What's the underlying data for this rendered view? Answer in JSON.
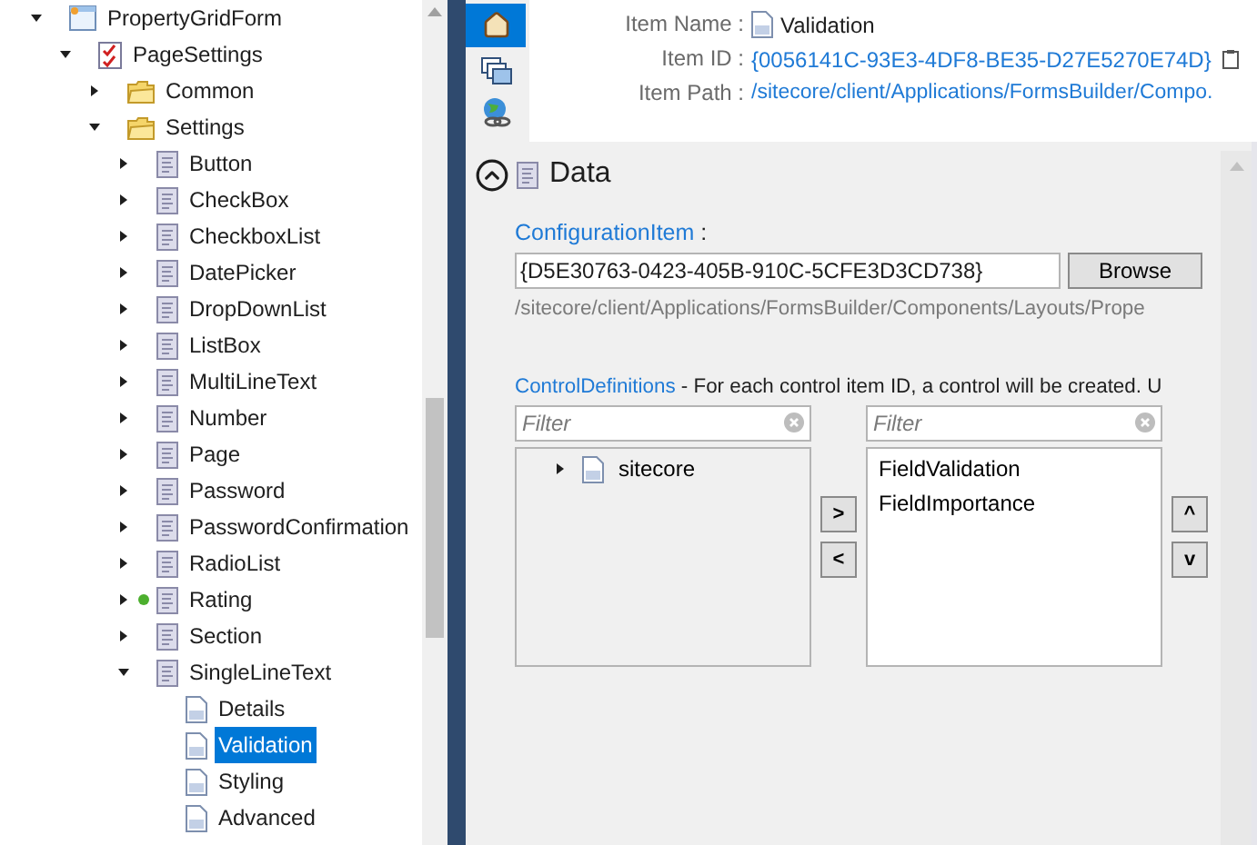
{
  "tree": [
    {
      "label": "PropertyGridForm",
      "kind": "form",
      "expanded": true,
      "selected": false,
      "marked": false,
      "children": [
        {
          "label": "PageSettings",
          "kind": "checklist",
          "expanded": true,
          "selected": false,
          "marked": false,
          "children": [
            {
              "label": "Common",
              "kind": "folder",
              "expanded": false,
              "selected": false,
              "marked": false
            },
            {
              "label": "Settings",
              "kind": "folder",
              "expanded": true,
              "selected": false,
              "marked": false,
              "children": [
                {
                  "label": "Button",
                  "kind": "template",
                  "expanded": false,
                  "selected": false,
                  "marked": false
                },
                {
                  "label": "CheckBox",
                  "kind": "template",
                  "expanded": false,
                  "selected": false,
                  "marked": false
                },
                {
                  "label": "CheckboxList",
                  "kind": "template",
                  "expanded": false,
                  "selected": false,
                  "marked": false
                },
                {
                  "label": "DatePicker",
                  "kind": "template",
                  "expanded": false,
                  "selected": false,
                  "marked": false
                },
                {
                  "label": "DropDownList",
                  "kind": "template",
                  "expanded": false,
                  "selected": false,
                  "marked": false
                },
                {
                  "label": "ListBox",
                  "kind": "template",
                  "expanded": false,
                  "selected": false,
                  "marked": false
                },
                {
                  "label": "MultiLineText",
                  "kind": "template",
                  "expanded": false,
                  "selected": false,
                  "marked": false
                },
                {
                  "label": "Number",
                  "kind": "template",
                  "expanded": false,
                  "selected": false,
                  "marked": false
                },
                {
                  "label": "Page",
                  "kind": "template",
                  "expanded": false,
                  "selected": false,
                  "marked": false
                },
                {
                  "label": "Password",
                  "kind": "template",
                  "expanded": false,
                  "selected": false,
                  "marked": false
                },
                {
                  "label": "PasswordConfirmation",
                  "kind": "template",
                  "expanded": false,
                  "selected": false,
                  "marked": false
                },
                {
                  "label": "RadioList",
                  "kind": "template",
                  "expanded": false,
                  "selected": false,
                  "marked": false
                },
                {
                  "label": "Rating",
                  "kind": "template",
                  "expanded": false,
                  "selected": false,
                  "marked": true
                },
                {
                  "label": "Section",
                  "kind": "template",
                  "expanded": false,
                  "selected": false,
                  "marked": false
                },
                {
                  "label": "SingleLineText",
                  "kind": "template",
                  "expanded": true,
                  "selected": false,
                  "marked": false,
                  "children": [
                    {
                      "label": "Details",
                      "kind": "page",
                      "selected": false,
                      "marked": false
                    },
                    {
                      "label": "Validation",
                      "kind": "page",
                      "selected": true,
                      "marked": false
                    },
                    {
                      "label": "Styling",
                      "kind": "page",
                      "selected": false,
                      "marked": false
                    },
                    {
                      "label": "Advanced",
                      "kind": "page",
                      "selected": false,
                      "marked": false
                    }
                  ]
                }
              ]
            }
          ]
        }
      ]
    }
  ],
  "side_tabs": [
    {
      "kind": "home",
      "selected": true
    },
    {
      "kind": "windows",
      "selected": false
    },
    {
      "kind": "globe",
      "selected": false
    }
  ],
  "header": {
    "fields": [
      {
        "label": "Item Name :",
        "value": "Validation",
        "kind": "name"
      },
      {
        "label": "Item ID :",
        "value": "{0056141C-93E3-4DF8-BE35-D27E5270E74D}",
        "kind": "id"
      },
      {
        "label": "Item Path :",
        "value": "/sitecore/client/Applications/FormsBuilder/Compo.",
        "kind": "path"
      }
    ]
  },
  "section": {
    "title": "Data",
    "expanded": true,
    "configuration_item": {
      "label": "ConfigurationItem",
      "suffix": ":",
      "value": "{D5E30763-0423-405B-910C-5CFE3D3CD738}",
      "button": "Browse",
      "path": "/sitecore/client/Applications/FormsBuilder/Components/Layouts/Prope"
    },
    "control_definitions": {
      "label": "ControlDefinitions",
      "description": " - For each control item ID, a control will be created. U",
      "left_filter": {
        "placeholder": "Filter"
      },
      "right_filter": {
        "placeholder": "Filter"
      },
      "available": [
        {
          "label": "sitecore",
          "expanded": false
        }
      ],
      "selected_items": [
        "FieldValidation",
        "FieldImportance"
      ],
      "move_buttons": [
        ">",
        "<"
      ],
      "order_buttons": [
        "^",
        "v"
      ]
    }
  }
}
